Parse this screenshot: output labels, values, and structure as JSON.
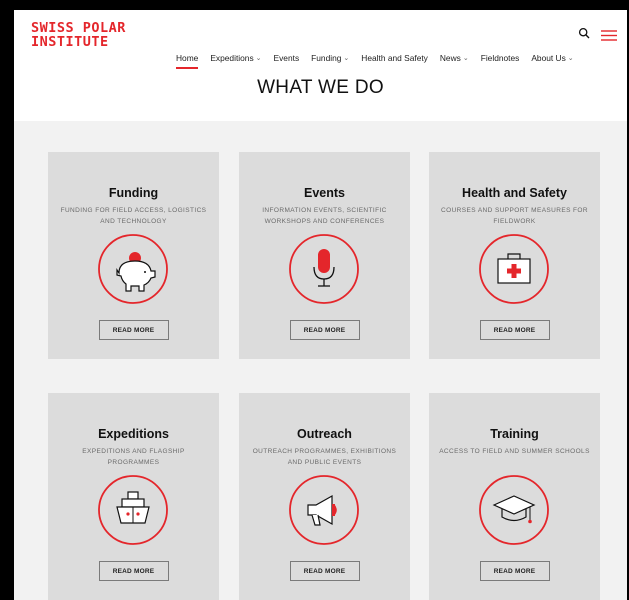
{
  "header": {
    "logo_line1": "SWISS POLAR",
    "logo_line2": "INSTITUTE",
    "icons": [
      "search-icon",
      "menu-icon"
    ]
  },
  "nav": {
    "items": [
      {
        "label": "Home",
        "has_dropdown": false,
        "active": true
      },
      {
        "label": "Expeditions",
        "has_dropdown": true
      },
      {
        "label": "Events",
        "has_dropdown": false
      },
      {
        "label": "Funding",
        "has_dropdown": true
      },
      {
        "label": "Health and Safety",
        "has_dropdown": false
      },
      {
        "label": "News",
        "has_dropdown": true
      },
      {
        "label": "Fieldnotes",
        "has_dropdown": false
      },
      {
        "label": "About Us",
        "has_dropdown": true
      }
    ],
    "chevron": "⌄"
  },
  "page_title": "WHAT WE DO",
  "colors": {
    "accent": "#e4262b",
    "card_bg": "#dcdcdc",
    "section_bg": "#f2f2f2"
  },
  "cards": [
    {
      "title": "Funding",
      "desc": "FUNDING FOR FIELD ACCESS, LOGISTICS AND TECHNOLOGY",
      "icon": "piggy-bank-icon",
      "button": "READ MORE"
    },
    {
      "title": "Events",
      "desc": "INFORMATION EVENTS, SCIENTIFIC WORKSHOPS AND CONFERENCES",
      "icon": "microphone-icon",
      "button": "READ MORE"
    },
    {
      "title": "Health and Safety",
      "desc": "COURSES AND SUPPORT MEASURES FOR FIELDWORK",
      "icon": "first-aid-kit-icon",
      "button": "READ MORE"
    },
    {
      "title": "Expeditions",
      "desc": "EXPEDITIONS AND FLAGSHIP PROGRAMMES",
      "icon": "ship-icon",
      "button": "READ MORE"
    },
    {
      "title": "Outreach",
      "desc": "OUTREACH PROGRAMMES, EXHIBITIONS AND PUBLIC EVENTS",
      "icon": "megaphone-icon",
      "button": "READ MORE"
    },
    {
      "title": "Training",
      "desc": "ACCESS TO FIELD AND SUMMER SCHOOLS",
      "icon": "graduation-cap-icon",
      "button": "READ MORE"
    }
  ]
}
